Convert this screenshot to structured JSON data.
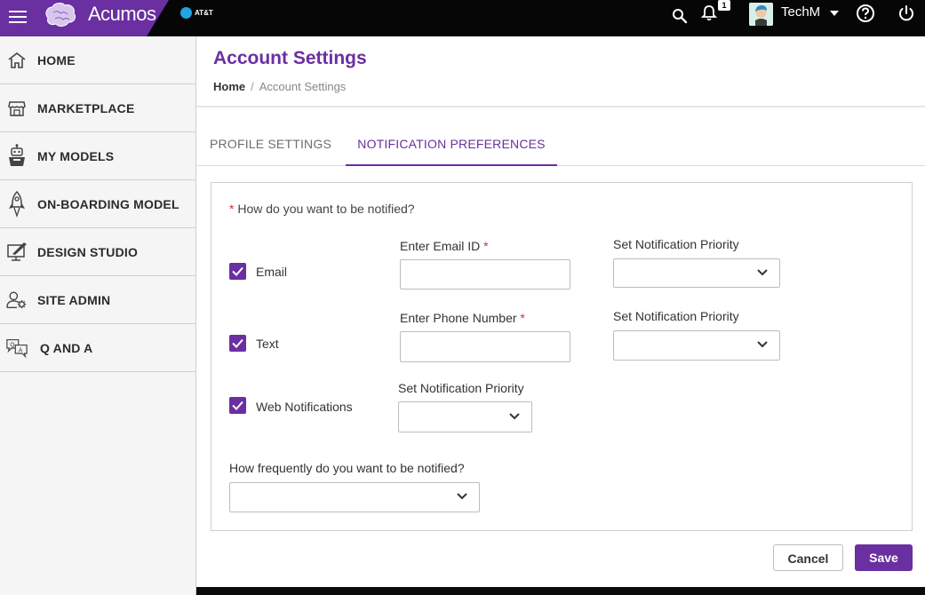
{
  "header": {
    "brand_name": "Acumos",
    "partner_logo_text": "AT&T",
    "notification_count": "1",
    "user_name": "TechM"
  },
  "sidebar": {
    "items": [
      {
        "label": "HOME",
        "icon": "home-icon"
      },
      {
        "label": "MARKETPLACE",
        "icon": "store-icon"
      },
      {
        "label": "MY MODELS",
        "icon": "robot-icon"
      },
      {
        "label": "ON-BOARDING MODEL",
        "icon": "rocket-icon"
      },
      {
        "label": "DESIGN STUDIO",
        "icon": "design-monitor-icon"
      },
      {
        "label": "SITE ADMIN",
        "icon": "user-gear-icon"
      },
      {
        "label": "Q AND A",
        "icon": "qa-chat-icon"
      }
    ]
  },
  "page": {
    "title": "Account Settings",
    "breadcrumb": {
      "home": "Home",
      "separator": "/",
      "current": "Account Settings"
    }
  },
  "tabs": [
    {
      "label": "PROFILE SETTINGS",
      "active": false
    },
    {
      "label": "NOTIFICATION PREFERENCES",
      "active": true
    }
  ],
  "form": {
    "required_marker": "*",
    "question": "How do you want to be notified?",
    "channels": [
      {
        "label": "Email",
        "checked": true,
        "input_label": "Enter Email ID",
        "input_value": "",
        "priority_label": "Set Notification Priority",
        "priority_value": ""
      },
      {
        "label": "Text",
        "checked": true,
        "input_label": "Enter Phone Number",
        "input_value": "",
        "priority_label": "Set Notification Priority",
        "priority_value": ""
      },
      {
        "label": "Web Notifications",
        "checked": true,
        "priority_label": "Set Notification Priority",
        "priority_value": ""
      }
    ],
    "frequency_label": "How frequently do you want to be notified?",
    "frequency_value": "",
    "cancel_label": "Cancel",
    "save_label": "Save"
  },
  "colors": {
    "accent": "#6a2fa1",
    "topbar": "#060606",
    "required": "#d0332d"
  }
}
